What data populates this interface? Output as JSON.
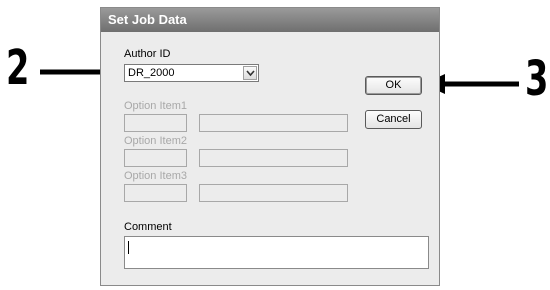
{
  "window": {
    "title": "Set Job Data"
  },
  "author": {
    "label": "Author ID",
    "value": "DR_2000"
  },
  "options": [
    {
      "label": "Option Item1"
    },
    {
      "label": "Option Item2"
    },
    {
      "label": "Option Item3"
    }
  ],
  "buttons": {
    "ok": "OK",
    "cancel": "Cancel"
  },
  "comment": {
    "label": "Comment",
    "value": ""
  },
  "callouts": {
    "left": "2",
    "right": "3"
  },
  "icons": {
    "combo_arrow": "chevron-down-icon",
    "callout_arrow": "arrow-icon"
  },
  "colors": {
    "titlebar": "#7a7a7a",
    "disabled_text": "#a8a8a8",
    "dialog_bg": "#ececec"
  }
}
